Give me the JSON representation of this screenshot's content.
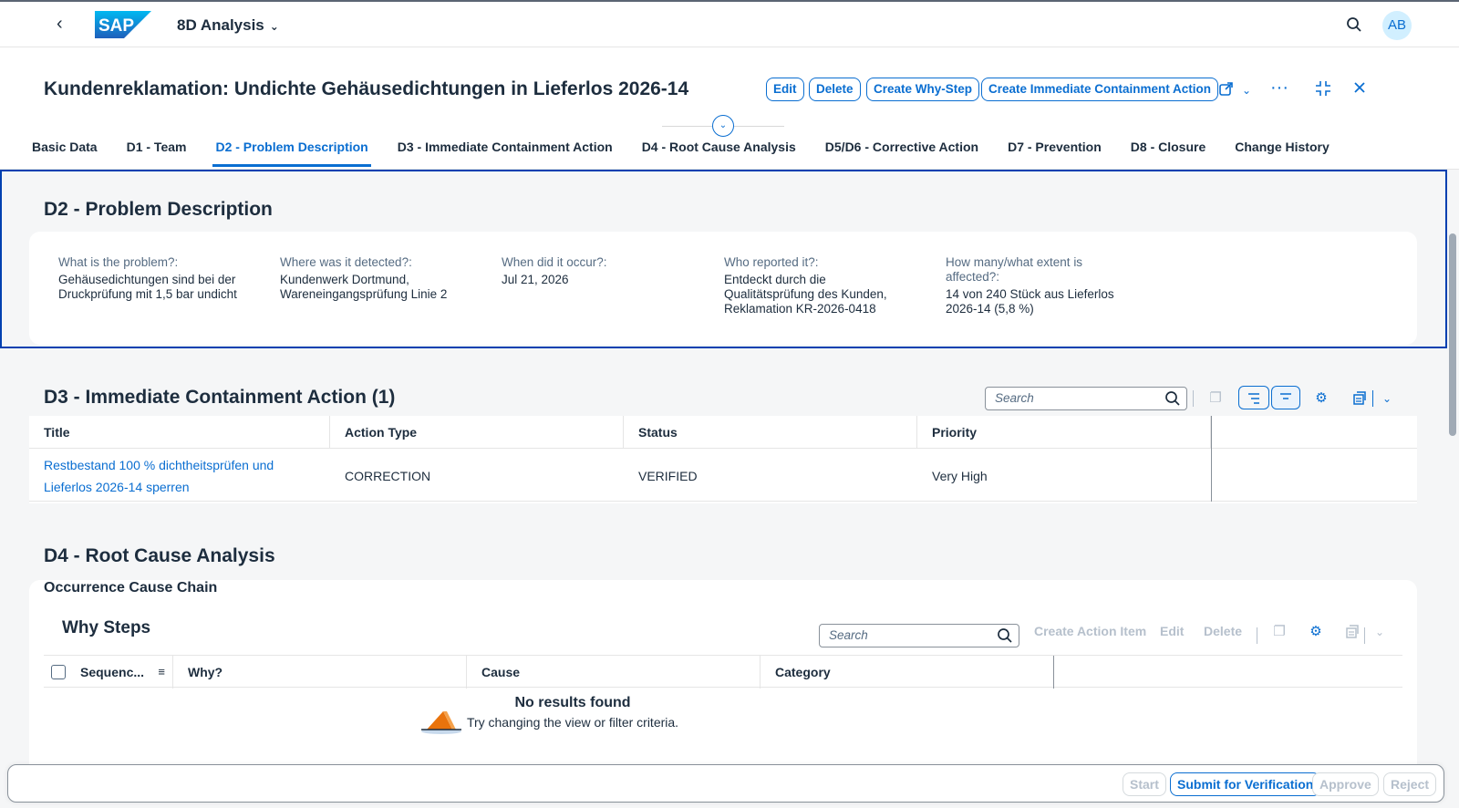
{
  "shell": {
    "app_title": "8D Analysis",
    "logo_text": "SAP",
    "avatar_initials": "AB"
  },
  "header": {
    "title": "Kundenreklamation: Undichte Gehäusedichtungen in Lieferlos 2026-14",
    "buttons": {
      "edit": "Edit",
      "delete": "Delete",
      "create_why_step": "Create Why-Step",
      "create_containment": "Create Immediate Containment Action"
    }
  },
  "tabs": [
    {
      "label": "Basic Data"
    },
    {
      "label": "D1 - Team"
    },
    {
      "label": "D2 - Problem Description"
    },
    {
      "label": "D3 - Immediate Containment Action"
    },
    {
      "label": "D4 - Root Cause Analysis"
    },
    {
      "label": "D5/D6 - Corrective Action"
    },
    {
      "label": "D7 - Prevention"
    },
    {
      "label": "D8 - Closure"
    },
    {
      "label": "Change History"
    }
  ],
  "d2": {
    "title": "D2 - Problem Description",
    "fields": [
      {
        "label": "What is the problem?:",
        "value": "Gehäusedichtungen sind bei der Druckprüfung mit 1,5 bar undicht"
      },
      {
        "label": "Where was it detected?:",
        "value": "Kundenwerk Dortmund, Wareneingangsprüfung Linie 2"
      },
      {
        "label": "When did it occur?:",
        "value": "Jul 21, 2026"
      },
      {
        "label": "Who reported it?:",
        "value": "Entdeckt durch die Qualitätsprüfung des Kunden, Reklamation KR-2026-0418"
      },
      {
        "label": "How many/what extent is affected?:",
        "value": "14 von 240 Stück aus Lieferlos 2026-14 (5,8 %)"
      }
    ]
  },
  "d3": {
    "title": "D3 - Immediate Containment Action (1)",
    "search_placeholder": "Search",
    "columns": [
      "Title",
      "Action Type",
      "Status",
      "Priority"
    ],
    "rows": [
      {
        "title": "Restbestand 100 % dichtheitsprüfen und Lieferlos 2026-14 sperren",
        "action_type": "CORRECTION",
        "status": "VERIFIED",
        "priority": "Very High"
      }
    ]
  },
  "d4": {
    "title": "D4 - Root Cause Analysis",
    "subtitle": "Occurrence Cause Chain",
    "why_title": "Why Steps",
    "search_placeholder": "Search",
    "toolbar": {
      "create_action_item": "Create Action Item",
      "edit": "Edit",
      "delete": "Delete"
    },
    "columns": [
      "Sequenc...",
      "Why?",
      "Cause",
      "Category"
    ],
    "empty_title": "No results found",
    "empty_text": "Try changing the view or filter criteria."
  },
  "footer": {
    "start": "Start",
    "submit": "Submit for Verification",
    "approve": "Approve",
    "reject": "Reject"
  },
  "colors": {
    "accent": "#0a6ed1",
    "text": "#1d2d3e",
    "disabled": "#b6c0cc"
  }
}
